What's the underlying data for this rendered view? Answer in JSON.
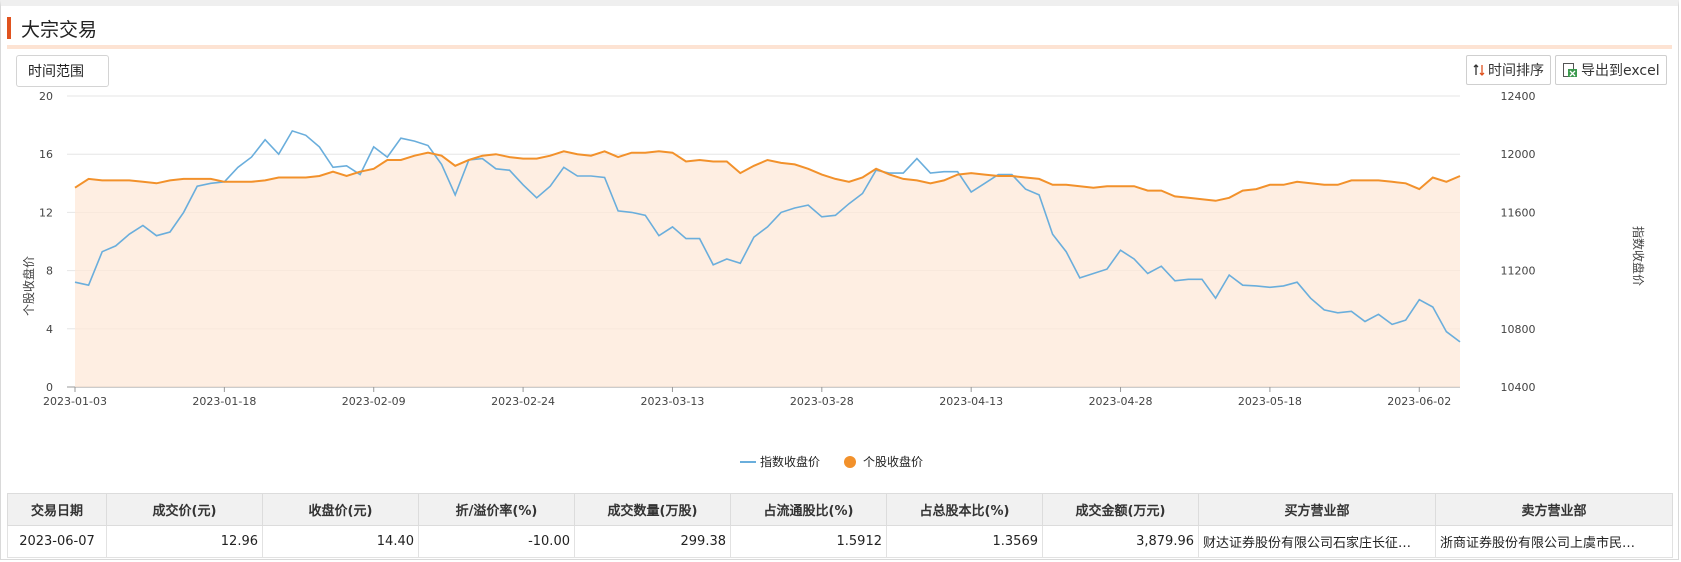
{
  "panel": {
    "title": "大宗交易"
  },
  "toolbar": {
    "range_label": "时间范围",
    "sort_label": "时间排序",
    "export_label": "导出到excel",
    "sort_icon": "sort-arrows-icon",
    "export_icon": "excel-export-icon"
  },
  "colors": {
    "accent": "#e0531f",
    "index_line": "#6aaedc",
    "stock_line": "#f2912b",
    "area_fill": "#fde8d8"
  },
  "chart_data": {
    "type": "line",
    "xlabel": "",
    "ylabel_left": "个股收盘价",
    "ylabel_right": "指数收盘价",
    "ylim_left": [
      0,
      20
    ],
    "ylim_right": [
      10400,
      12400
    ],
    "yticks_left": [
      "0",
      "4",
      "8",
      "12",
      "16",
      "20"
    ],
    "yticks_right": [
      "10400",
      "10800",
      "11200",
      "11600",
      "12000",
      "12400"
    ],
    "x_ticks": [
      "2023-01-03",
      "2023-01-18",
      "2023-02-09",
      "2023-02-24",
      "2023-03-13",
      "2023-03-28",
      "2023-04-13",
      "2023-04-28",
      "2023-05-18",
      "2023-06-02"
    ],
    "x_tick_indices": [
      0,
      11,
      22,
      33,
      44,
      55,
      66,
      77,
      88,
      99
    ],
    "grid": true,
    "legend_position": "bottom-center",
    "series": [
      {
        "name": "指数收盘价",
        "axis": "right",
        "values": [
          11120,
          11100,
          11330,
          11370,
          11450,
          11510,
          11440,
          11465,
          11600,
          11780,
          11800,
          11810,
          11910,
          11980,
          12100,
          12000,
          12160,
          12130,
          12050,
          11910,
          11920,
          11860,
          12050,
          11980,
          12110,
          12090,
          12060,
          11930,
          11720,
          11960,
          11970,
          11900,
          11890,
          11790,
          11700,
          11780,
          11910,
          11850,
          11850,
          11840,
          11610,
          11600,
          11580,
          11440,
          11500,
          11420,
          11420,
          11240,
          11280,
          11250,
          11430,
          11500,
          11600,
          11630,
          11650,
          11570,
          11580,
          11660,
          11730,
          11890,
          11870,
          11870,
          11970,
          11870,
          11880,
          11880,
          11740,
          11800,
          11860,
          11860,
          11760,
          11720,
          11450,
          11330,
          11150,
          11180,
          11210,
          11340,
          11280,
          11180,
          11230,
          11130,
          11140,
          11140,
          11010,
          11170,
          11100,
          11095,
          11085,
          11095,
          11120,
          11010,
          10930,
          10910,
          10920,
          10850,
          10900,
          10830,
          10860,
          11000,
          10950,
          10780,
          10710
        ]
      },
      {
        "name": "个股收盘价",
        "axis": "left",
        "values": [
          13.7,
          14.3,
          14.2,
          14.2,
          14.2,
          14.1,
          14.0,
          14.2,
          14.3,
          14.3,
          14.3,
          14.1,
          14.1,
          14.1,
          14.2,
          14.4,
          14.4,
          14.4,
          14.5,
          14.8,
          14.5,
          14.8,
          15.0,
          15.6,
          15.6,
          15.9,
          16.1,
          15.9,
          15.2,
          15.6,
          15.9,
          16.0,
          15.8,
          15.7,
          15.7,
          15.9,
          16.2,
          16.0,
          15.9,
          16.2,
          15.8,
          16.1,
          16.1,
          16.2,
          16.1,
          15.5,
          15.6,
          15.5,
          15.5,
          14.7,
          15.2,
          15.6,
          15.4,
          15.3,
          15.0,
          14.6,
          14.3,
          14.1,
          14.4,
          15.0,
          14.6,
          14.3,
          14.2,
          14.0,
          14.2,
          14.6,
          14.7,
          14.6,
          14.5,
          14.5,
          14.4,
          14.3,
          13.9,
          13.9,
          13.8,
          13.7,
          13.8,
          13.8,
          13.8,
          13.5,
          13.5,
          13.1,
          13.0,
          12.9,
          12.8,
          13.0,
          13.5,
          13.6,
          13.9,
          13.9,
          14.1,
          14.0,
          13.9,
          13.9,
          14.2,
          14.2,
          14.2,
          14.1,
          14.0,
          13.6,
          14.4,
          14.1,
          14.5
        ]
      }
    ]
  },
  "table": {
    "headers": [
      "交易日期",
      "成交价(元)",
      "收盘价(元)",
      "折/溢价率(%)",
      "成交数量(万股)",
      "占流通股比(%)",
      "占总股本比(%)",
      "成交金额(万元)",
      "买方营业部",
      "卖方营业部"
    ],
    "rows": [
      [
        "2023-06-07",
        "12.96",
        "14.40",
        "-10.00",
        "299.38",
        "1.5912",
        "1.3569",
        "3,879.96",
        "财达证券股份有限公司石家庄长征…",
        "浙商证券股份有限公司上虞市民…"
      ]
    ]
  }
}
